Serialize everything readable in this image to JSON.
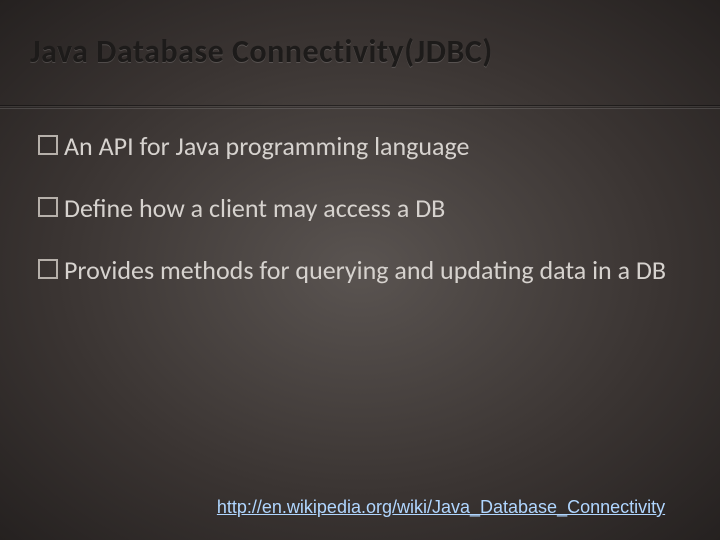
{
  "title": "Java Database Connectivity(JDBC)",
  "bullets": [
    {
      "first": "An",
      "rest": " API for Java programming language"
    },
    {
      "first": "Define",
      "rest": " how a client may access a DB"
    },
    {
      "first": "Provides",
      "rest": " methods for querying and updating data in a DB"
    }
  ],
  "link": {
    "text": "http://en.wikipedia.org/wiki/Java_Database_Connectivity",
    "href": "http://en.wikipedia.org/wiki/Java_Database_Connectivity"
  }
}
